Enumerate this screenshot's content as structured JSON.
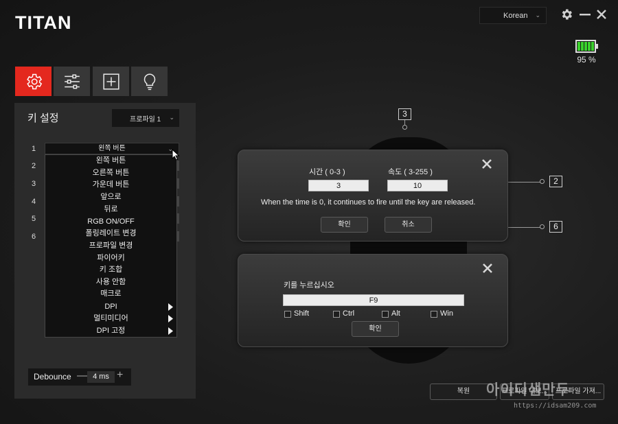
{
  "app": {
    "title": "TITAN"
  },
  "header": {
    "language": "Korean",
    "battery_percent": "95 %",
    "battery_level": 0.95,
    "icons": [
      "gear-icon",
      "minimize-icon",
      "close-icon"
    ]
  },
  "tabs": [
    {
      "icon": "settings-gear-icon",
      "active": true
    },
    {
      "icon": "sliders-icon",
      "active": false
    },
    {
      "icon": "macro-plus-icon",
      "active": false
    },
    {
      "icon": "lightbulb-icon",
      "active": false
    }
  ],
  "key_settings": {
    "title": "키 설정",
    "profile": "프로파일 1",
    "rows": [
      "1",
      "2",
      "3",
      "4",
      "5",
      "6"
    ],
    "selected": "왼쪽 버튼",
    "dropdown": [
      {
        "label": "왼쪽 버튼",
        "submenu": false
      },
      {
        "label": "오른쪽 버튼",
        "submenu": false
      },
      {
        "label": "가운데 버튼",
        "submenu": false
      },
      {
        "label": "앞으로",
        "submenu": false
      },
      {
        "label": "뒤로",
        "submenu": false
      },
      {
        "label": "RGB ON/OFF",
        "submenu": false
      },
      {
        "label": "폴링레이트 변경",
        "submenu": false
      },
      {
        "label": "프로파일 변경",
        "submenu": false
      },
      {
        "label": "파이어키",
        "submenu": false
      },
      {
        "label": "키 조합",
        "submenu": false
      },
      {
        "label": "사용 안함",
        "submenu": false
      },
      {
        "label": "매크로",
        "submenu": false
      },
      {
        "label": "DPI",
        "submenu": true
      },
      {
        "label": "멀티미디어",
        "submenu": true
      },
      {
        "label": "DPI 고정",
        "submenu": true
      }
    ],
    "debounce_label": "Debounce",
    "debounce_value": "4 ms"
  },
  "mouse_callouts": [
    "3",
    "2",
    "6"
  ],
  "fire_dialog": {
    "time_label": "시간 ( 0-3 )",
    "speed_label": "속도 ( 3-255 )",
    "time_value": "3",
    "speed_value": "10",
    "note": "When the time is 0, it continues to fire until the key are released.",
    "ok": "확인",
    "cancel": "취소"
  },
  "key_combo_dialog": {
    "prompt": "키를 누르십시오",
    "value": "F9",
    "modifiers": [
      "Shift",
      "Ctrl",
      "Alt",
      "Win"
    ],
    "ok": "확인"
  },
  "bottom": {
    "restore": "복원",
    "save_profile": "프로파일 내보...",
    "load_profile": "프로파일 가져..."
  },
  "watermark": {
    "text": "아이디샘만두",
    "url": "https://idsam209.com"
  }
}
